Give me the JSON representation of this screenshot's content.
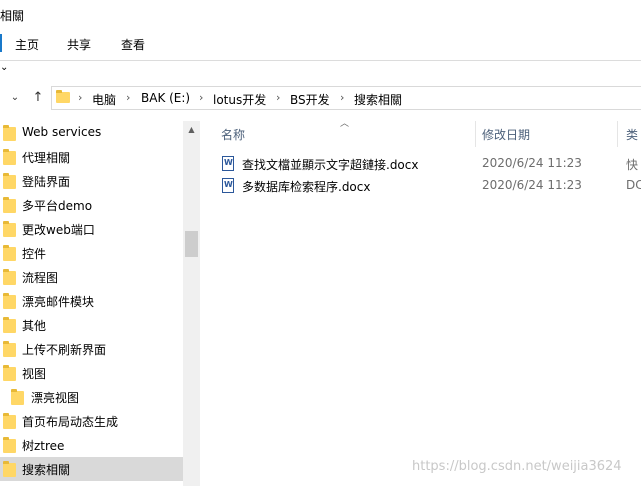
{
  "window": {
    "title": "相關"
  },
  "ribbon": {
    "tabs": [
      "主页",
      "共享",
      "查看"
    ],
    "minimize_glyph": "⌄"
  },
  "nav": {
    "back": "←",
    "forward": "→",
    "recent": "⌄",
    "up": "↑"
  },
  "address": {
    "crumbs": [
      "电脑",
      "BAK (E:)",
      "lotus开发",
      "BS开发",
      "搜索相關"
    ],
    "separator": "›"
  },
  "tree": [
    {
      "label": "Web services",
      "sub": false,
      "selected": false
    },
    {
      "label": "代理相關",
      "sub": false,
      "selected": false
    },
    {
      "label": "登陆界面",
      "sub": false,
      "selected": false
    },
    {
      "label": "多平台demo",
      "sub": false,
      "selected": false
    },
    {
      "label": "更改web端口",
      "sub": false,
      "selected": false
    },
    {
      "label": "控件",
      "sub": false,
      "selected": false
    },
    {
      "label": "流程图",
      "sub": false,
      "selected": false
    },
    {
      "label": "漂亮邮件模块",
      "sub": false,
      "selected": false
    },
    {
      "label": "其他",
      "sub": false,
      "selected": false
    },
    {
      "label": "上传不刷新界面",
      "sub": false,
      "selected": false
    },
    {
      "label": "视图",
      "sub": false,
      "selected": false
    },
    {
      "label": "漂亮视图",
      "sub": true,
      "selected": false
    },
    {
      "label": "首页布局动态生成",
      "sub": false,
      "selected": false
    },
    {
      "label": "树ztree",
      "sub": false,
      "selected": false
    },
    {
      "label": "搜索相關",
      "sub": false,
      "selected": true
    }
  ],
  "columns": {
    "name": "名称",
    "date": "修改日期",
    "type": "类"
  },
  "files": [
    {
      "name": "查找文檔並顯示文字超鏈接.docx",
      "date": "2020/6/24 11:23",
      "type": "快"
    },
    {
      "name": "多数据库检索程序.docx",
      "date": "2020/6/24 11:23",
      "type": "DC"
    }
  ],
  "watermark": "https://blog.csdn.net/weijia3624",
  "colors": {
    "folder": "#ffd766",
    "selection": "#d9d9d9",
    "accent": "#1979ca",
    "header_text": "#4c607a"
  }
}
